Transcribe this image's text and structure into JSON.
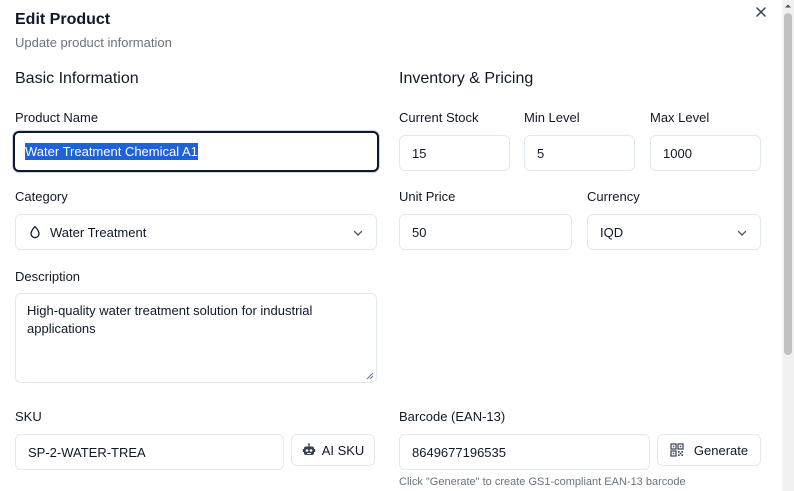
{
  "dialog": {
    "title": "Edit Product",
    "subtitle": "Update product information",
    "close_icon": "close-icon"
  },
  "basic": {
    "section_title": "Basic Information",
    "product_name_label": "Product Name",
    "product_name_value": "Water Treatment Chemical A1",
    "category_label": "Category",
    "category_value": "Water Treatment",
    "category_icon": "droplet-icon",
    "description_label": "Description",
    "description_value": "High-quality water treatment solution for industrial applications",
    "sku_label": "SKU",
    "sku_value": "SP-2-WATER-TREA",
    "ai_sku_button": "AI SKU",
    "ai_sku_icon": "robot-icon"
  },
  "inventory": {
    "section_title": "Inventory & Pricing",
    "current_stock_label": "Current Stock",
    "current_stock_value": "15",
    "min_level_label": "Min Level",
    "min_level_value": "5",
    "max_level_label": "Max Level",
    "max_level_value": "1000",
    "unit_price_label": "Unit Price",
    "unit_price_value": "50",
    "currency_label": "Currency",
    "currency_value": "IQD",
    "barcode_label": "Barcode (EAN-13)",
    "barcode_value": "8649677196535",
    "generate_button": "Generate",
    "generate_icon": "qr-code-icon",
    "barcode_hint": "Click \"Generate\" to create GS1-compliant EAN-13 barcode"
  },
  "colors": {
    "selection": "#1e63d6",
    "border": "#e2e8f0",
    "focus": "#0f172a",
    "muted": "#6b7280"
  }
}
